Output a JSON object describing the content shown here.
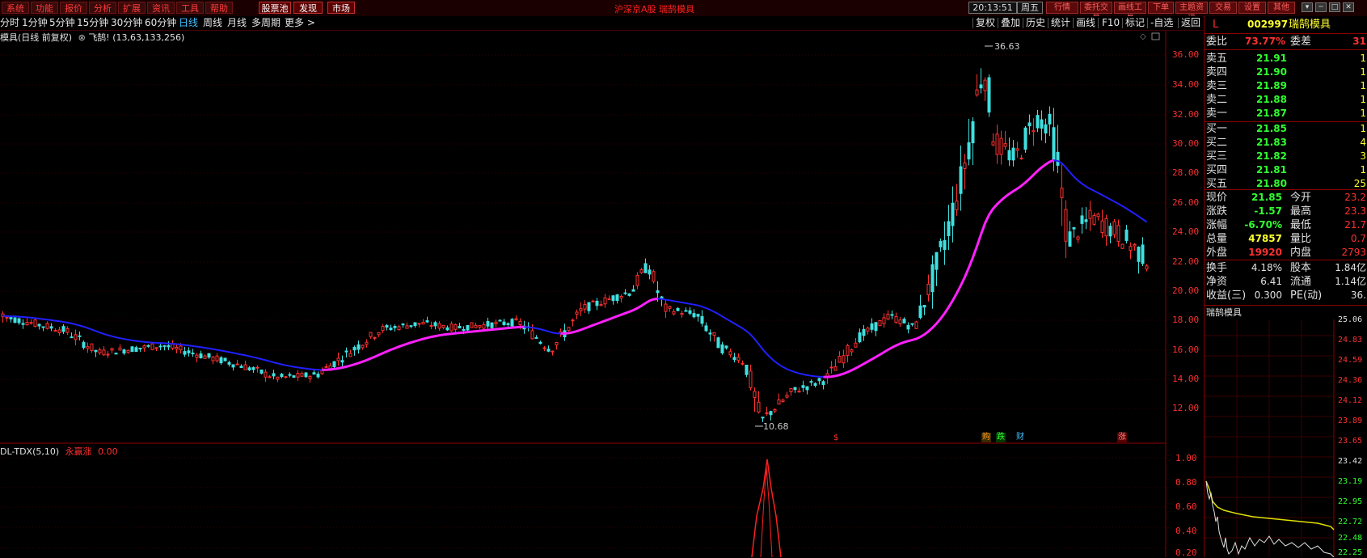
{
  "menu": {
    "items": [
      "系统",
      "功能",
      "报价",
      "分析",
      "扩展",
      "资讯",
      "工具",
      "帮助"
    ],
    "special": [
      "股票池",
      "发现",
      "市场"
    ],
    "window_title": "沪深京A股 瑞鹄模具",
    "clock": "20:13:51",
    "weekday": "周五",
    "right_buttons": [
      "行情",
      "委托交易",
      "画线工具",
      "下单",
      "主题资讯",
      "交易",
      "设置",
      "其他"
    ],
    "window_controls": [
      "▾",
      "─",
      "□",
      "✕"
    ]
  },
  "periods": {
    "items": [
      "分时",
      "1分钟",
      "5分钟",
      "15分钟",
      "30分钟",
      "60分钟",
      "日线",
      "周线",
      "月线",
      "多周期",
      "更多 >"
    ],
    "active": "日线",
    "tools": [
      "复权",
      "叠加",
      "历史",
      "统计",
      "画线",
      "F10",
      "标记",
      "-自选",
      "返回"
    ]
  },
  "chart": {
    "info": "模具(日线 前复权)",
    "indicator": "飞鹄! (13,63,133,256)",
    "high_label": "36.63",
    "low_label": "10.68",
    "price_axis": [
      "36.00",
      "34.00",
      "32.00",
      "30.00",
      "28.00",
      "26.00",
      "24.00",
      "22.00",
      "20.00",
      "18.00",
      "16.00",
      "14.00",
      "12.00"
    ],
    "events": [
      {
        "text": "$",
        "color": "#ff3030"
      },
      {
        "text": "购",
        "color": "#ffa020"
      },
      {
        "text": "跌",
        "color": "#30ff30"
      },
      {
        "text": "财",
        "color": "#40c0ff"
      },
      {
        "text": "涨",
        "color": "#ff3030"
      }
    ]
  },
  "indicator_panel": {
    "name": "DL-TDX(5,10)",
    "series_name": "永赢涨",
    "value": "0.00",
    "axis": [
      "1.00",
      "0.80",
      "0.60",
      "0.40",
      "0.20"
    ]
  },
  "quote": {
    "market_flag": "L",
    "code": "002997",
    "name": "瑞鹄模具",
    "weibi_label": "委比",
    "weibi": "73.77%",
    "weicha_label": "委差",
    "weicha": "31",
    "sell": [
      {
        "label": "卖五",
        "price": "21.91",
        "vol": "1"
      },
      {
        "label": "卖四",
        "price": "21.90",
        "vol": "1"
      },
      {
        "label": "卖三",
        "price": "21.89",
        "vol": "1"
      },
      {
        "label": "卖二",
        "price": "21.88",
        "vol": "1"
      },
      {
        "label": "卖一",
        "price": "21.87",
        "vol": "1"
      }
    ],
    "buy": [
      {
        "label": "买一",
        "price": "21.85",
        "vol": "1"
      },
      {
        "label": "买二",
        "price": "21.83",
        "vol": "4"
      },
      {
        "label": "买三",
        "price": "21.82",
        "vol": "3"
      },
      {
        "label": "买四",
        "price": "21.81",
        "vol": "1"
      },
      {
        "label": "买五",
        "price": "21.80",
        "vol": "25"
      }
    ],
    "stats": [
      {
        "l1": "现价",
        "v1": "21.85",
        "c1": "#30ff30",
        "l2": "今开",
        "v2": "23.2"
      },
      {
        "l1": "涨跌",
        "v1": "-1.57",
        "c1": "#30ff30",
        "l2": "最高",
        "v2": "23.3"
      },
      {
        "l1": "涨幅",
        "v1": "-6.70%",
        "c1": "#30ff30",
        "l2": "最低",
        "v2": "21.7"
      },
      {
        "l1": "总量",
        "v1": "47857",
        "c1": "#ffff30",
        "l2": "量比",
        "v2": "0.7"
      },
      {
        "l1": "外盘",
        "v1": "19920",
        "c1": "#ff3030",
        "l2": "内盘",
        "v2": "2793"
      }
    ],
    "fin": [
      {
        "l1": "换手",
        "v1": "4.18%",
        "l2": "股本",
        "v2": "1.84亿"
      },
      {
        "l1": "净资",
        "v1": "6.41",
        "l2": "流通",
        "v2": "1.14亿"
      },
      {
        "l1": "收益(三)",
        "v1": "0.300",
        "l2": "PE(动)",
        "v2": "36."
      }
    ]
  },
  "mini_chart": {
    "title": "瑞鹄模具",
    "axis": [
      "25.06",
      "24.83",
      "24.59",
      "24.36",
      "24.12",
      "23.89",
      "23.65",
      "23.42",
      "23.19",
      "22.95",
      "22.72",
      "22.48",
      "22.25"
    ]
  },
  "colors": {
    "up": "#ff3030",
    "down": "#40e0e0",
    "ma_up": "#ff20ff",
    "ma_down": "#2020ff",
    "grid": "#3a0000"
  }
}
